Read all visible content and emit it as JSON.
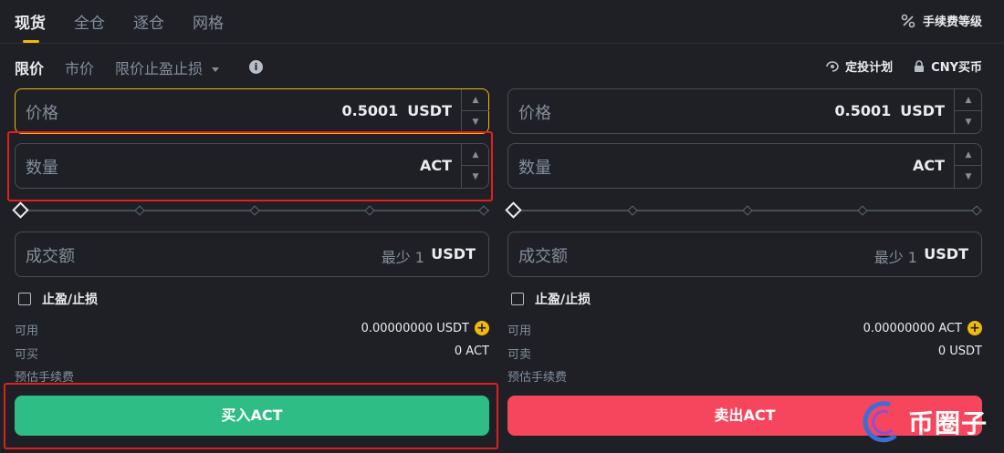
{
  "tabs": [
    {
      "label": "现货",
      "active": true
    },
    {
      "label": "全仓",
      "active": false
    },
    {
      "label": "逐仓",
      "active": false
    },
    {
      "label": "网格",
      "active": false
    }
  ],
  "fee_level": {
    "label": "手续费等级",
    "icon": "percent-icon"
  },
  "order_types": [
    {
      "label": "限价",
      "active": true
    },
    {
      "label": "市价",
      "active": false
    },
    {
      "label": "限价止盈止损",
      "active": false
    }
  ],
  "order_type_dropdown_icon": "caret-down-icon",
  "info_icon": "info-icon",
  "right_links": {
    "recurring_plan": "定投计划",
    "cny_buy": "CNY买币"
  },
  "buy": {
    "price_label": "价格",
    "price_value": "0.5001",
    "price_unit": "USDT",
    "amount_label": "数量",
    "amount_unit": "ACT",
    "total_label": "成交额",
    "total_min": "最少 1",
    "total_unit": "USDT",
    "tp_sl_label": "止盈/止损",
    "available_label": "可用",
    "available_value": "0.00000000 USDT",
    "max_label": "可买",
    "max_value": "0 ACT",
    "fee_label": "预估手续费",
    "button_label": "买入ACT",
    "slider_percent": 0
  },
  "sell": {
    "price_label": "价格",
    "price_value": "0.5001",
    "price_unit": "USDT",
    "amount_label": "数量",
    "amount_unit": "ACT",
    "total_label": "成交额",
    "total_min": "最少 1",
    "total_unit": "USDT",
    "tp_sl_label": "止盈/止损",
    "available_label": "可用",
    "available_value": "0.00000000 ACT",
    "max_label": "可卖",
    "max_value": "0 USDT",
    "fee_label": "预估手续费",
    "button_label": "卖出ACT",
    "slider_percent": 0
  },
  "watermark": {
    "text": "币圈子"
  },
  "colors": {
    "background": "#1e2026",
    "accent": "#f0b90b",
    "buy": "#2ebd85",
    "sell": "#f6465d",
    "highlight": "#e02020"
  }
}
